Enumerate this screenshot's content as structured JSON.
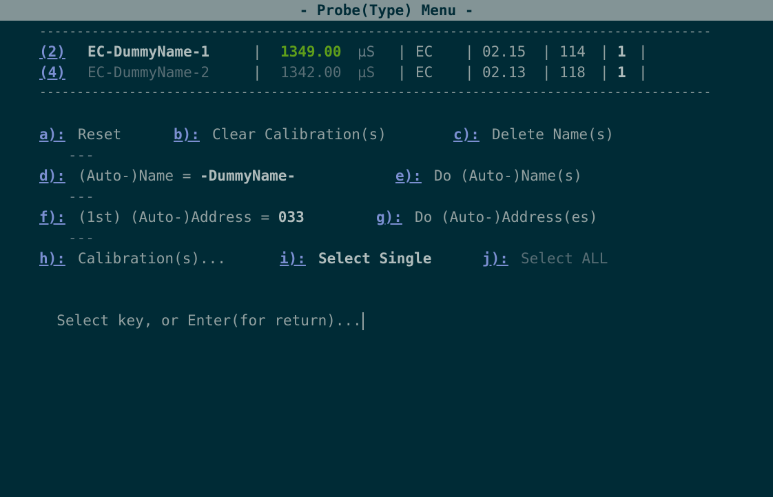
{
  "window": {
    "title": "- Probe(Type) Menu -"
  },
  "table": {
    "separator": "------------------------------------------------------------------------------------------",
    "rows": [
      {
        "key": "(2)",
        "name": "EC-DummyName-1",
        "value": "1349.00",
        "unit": "µS",
        "type": "EC",
        "version": "02.15",
        "address": "114",
        "count": "1"
      },
      {
        "key": "(4)",
        "name": "EC-DummyName-2",
        "value": "1342.00",
        "unit": "µS",
        "type": "EC",
        "version": "02.13",
        "address": "118",
        "count": "1"
      }
    ]
  },
  "menu": {
    "a_key": "a):",
    "a_label": "Reset",
    "b_key": "b):",
    "b_label": "Clear Calibration(s)",
    "c_key": "c):",
    "c_label": "Delete Name(s)",
    "spacer": "---",
    "d_key": "d):",
    "d_label": "(Auto-)Name = ",
    "d_value": "-DummyName-",
    "e_key": "e):",
    "e_label": "Do (Auto-)Name(s)",
    "f_key": "f):",
    "f_label": "(1st) (Auto-)Address = ",
    "f_value": "033",
    "g_key": "g):",
    "g_label": "Do (Auto-)Address(es)",
    "h_key": "h):",
    "h_label": "Calibration(s)...",
    "i_key": "i):",
    "i_label": "Select Single",
    "j_key": "j):",
    "j_label": "Select ALL"
  },
  "prompt": {
    "text": "Select key, or Enter(for return)..."
  }
}
